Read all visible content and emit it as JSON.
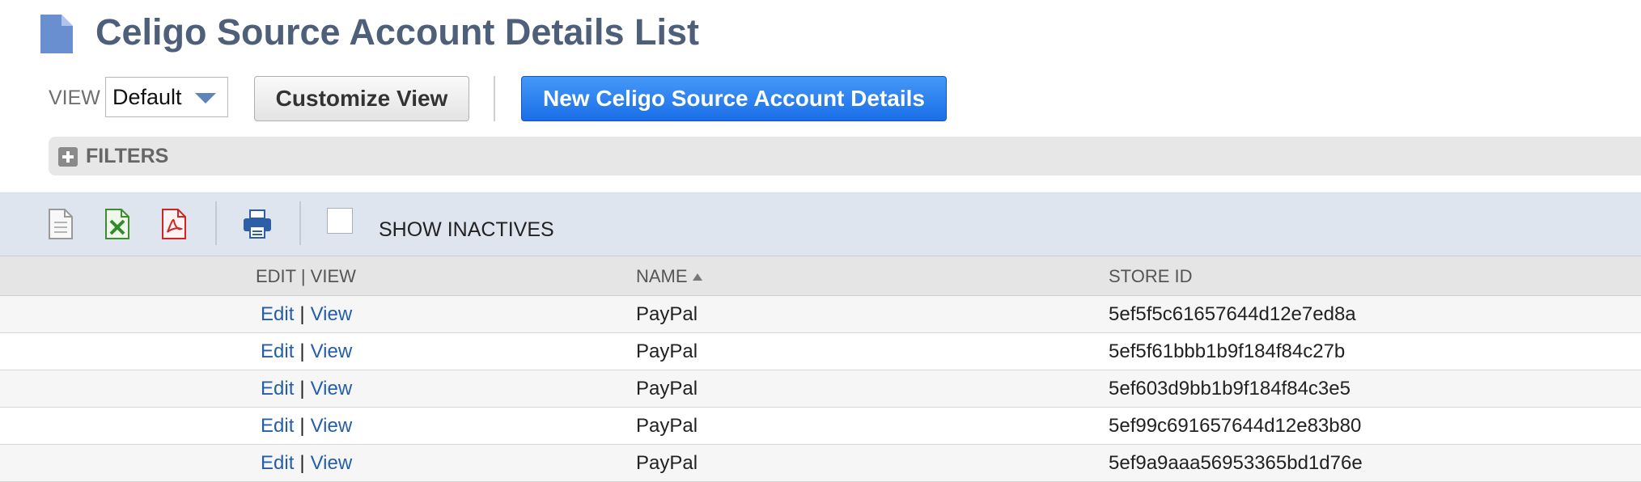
{
  "header": {
    "title": "Celigo Source Account Details List",
    "icon": "document-icon"
  },
  "controls": {
    "view_label": "VIEW",
    "view_selected": "Default",
    "customize_label": "Customize View",
    "new_label": "New Celigo Source Account Details"
  },
  "filters": {
    "label": "FILTERS"
  },
  "toolbar": {
    "icons": [
      "export-csv-icon",
      "export-excel-icon",
      "export-pdf-icon",
      "print-icon"
    ],
    "show_inactives_label": "SHOW INACTIVES",
    "show_inactives_checked": false
  },
  "table": {
    "columns": {
      "edit_view": "EDIT | VIEW",
      "name": "NAME",
      "store_id": "STORE ID"
    },
    "sort": {
      "column": "name",
      "direction": "ascending"
    },
    "rows": [
      {
        "edit": "Edit",
        "sep": "|",
        "view": "View",
        "name": "PayPal",
        "store_id": "5ef5f5c61657644d12e7ed8a"
      },
      {
        "edit": "Edit",
        "sep": "|",
        "view": "View",
        "name": "PayPal",
        "store_id": "5ef5f61bbb1b9f184f84c27b"
      },
      {
        "edit": "Edit",
        "sep": "|",
        "view": "View",
        "name": "PayPal",
        "store_id": "5ef603d9bb1b9f184f84c3e5"
      },
      {
        "edit": "Edit",
        "sep": "|",
        "view": "View",
        "name": "PayPal",
        "store_id": "5ef99c691657644d12e83b80"
      },
      {
        "edit": "Edit",
        "sep": "|",
        "view": "View",
        "name": "PayPal",
        "store_id": "5ef9a9aaa56953365bd1d76e"
      }
    ]
  },
  "colors": {
    "title": "#4d5f79",
    "link": "#255ea8",
    "primary_button": "#1a6ee8",
    "toolbar_bg": "#dfe5ef"
  }
}
